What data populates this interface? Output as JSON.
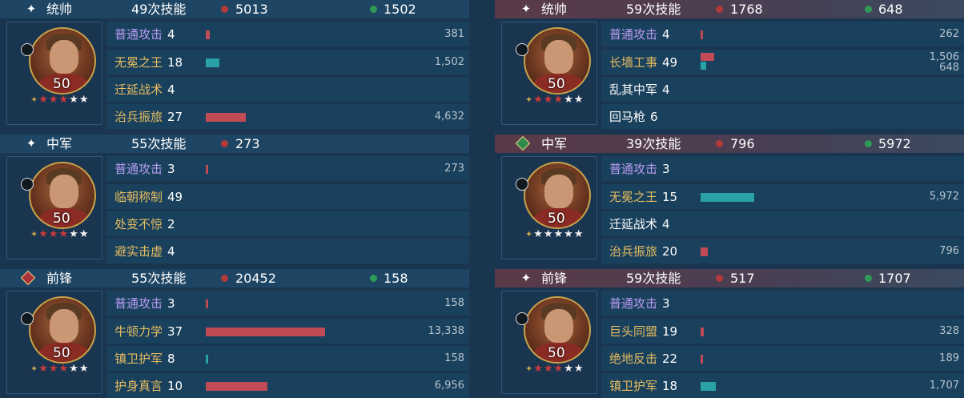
{
  "left": {
    "groups": [
      {
        "role": "统帅",
        "skills": "49次技能",
        "damage": "5013",
        "heal": "1502",
        "level": "50",
        "stars_red": "★★★",
        "stars_white": "★★",
        "rows": [
          {
            "name": "普通攻击",
            "count": "4",
            "value": "381",
            "bar": 0.02,
            "color": "red",
            "type": "basic"
          },
          {
            "name": "无冕之王",
            "count": "18",
            "value": "1,502",
            "bar": 0.07,
            "color": "teal",
            "type": "skill"
          },
          {
            "name": "迁延战术",
            "count": "4",
            "value": "",
            "bar": 0,
            "color": "red",
            "type": "skill"
          },
          {
            "name": "治兵振旅",
            "count": "27",
            "value": "4,632",
            "bar": 0.2,
            "color": "red",
            "type": "skill"
          }
        ]
      },
      {
        "role": "中军",
        "skills": "55次技能",
        "damage": "273",
        "heal": "",
        "level": "50",
        "stars_red": "★★★",
        "stars_white": "★★",
        "rows": [
          {
            "name": "普通攻击",
            "count": "3",
            "value": "273",
            "bar": 0.012,
            "color": "red",
            "type": "basic"
          },
          {
            "name": "临朝称制",
            "count": "49",
            "value": "",
            "bar": 0,
            "color": "red",
            "type": "skill"
          },
          {
            "name": "处变不惊",
            "count": "2",
            "value": "",
            "bar": 0,
            "color": "red",
            "type": "skill"
          },
          {
            "name": "避实击虚",
            "count": "4",
            "value": "",
            "bar": 0,
            "color": "red",
            "type": "skill"
          }
        ]
      },
      {
        "role": "前锋",
        "skills": "55次技能",
        "damage": "20452",
        "heal": "158",
        "level": "50",
        "stars_red": "★★★",
        "stars_white": "★★",
        "rows": [
          {
            "name": "普通攻击",
            "count": "3",
            "value": "158",
            "bar": 0.008,
            "color": "red",
            "type": "basic"
          },
          {
            "name": "牛顿力学",
            "count": "37",
            "value": "13,338",
            "bar": 0.6,
            "color": "red",
            "type": "skill"
          },
          {
            "name": "镇卫护军",
            "count": "8",
            "value": "158",
            "bar": 0.008,
            "color": "teal",
            "type": "skill"
          },
          {
            "name": "护身真言",
            "count": "10",
            "value": "6,956",
            "bar": 0.31,
            "color": "red",
            "type": "skill"
          }
        ]
      }
    ]
  },
  "right": {
    "groups": [
      {
        "role": "统帅",
        "skills": "59次技能",
        "damage": "1768",
        "heal": "648",
        "level": "50",
        "stars_red": "★★★",
        "stars_white": "★★",
        "rows": [
          {
            "name": "普通攻击",
            "count": "4",
            "value": "262",
            "bar": 0.012,
            "color": "red",
            "type": "basic"
          },
          {
            "name": "长墙工事",
            "count": "49",
            "value": "1,506",
            "value2": "648",
            "bar": 0.07,
            "bar2": 0.03,
            "color": "red",
            "type": "skill"
          },
          {
            "name": "乱其中军",
            "count": "4",
            "value": "",
            "bar": 0,
            "color": "red",
            "type": "plain"
          },
          {
            "name": "回马枪",
            "count": "6",
            "value": "",
            "bar": 0,
            "color": "red",
            "type": "plain"
          }
        ]
      },
      {
        "role": "中军",
        "skills": "39次技能",
        "damage": "796",
        "heal": "5972",
        "level": "50",
        "stars_red": "",
        "stars_white": "★★★★★",
        "rows": [
          {
            "name": "普通攻击",
            "count": "3",
            "value": "",
            "bar": 0,
            "color": "red",
            "type": "basic"
          },
          {
            "name": "无冕之王",
            "count": "15",
            "value": "5,972",
            "bar": 0.27,
            "color": "teal",
            "type": "skill"
          },
          {
            "name": "迁延战术",
            "count": "4",
            "value": "",
            "bar": 0,
            "color": "red",
            "type": "plain"
          },
          {
            "name": "治兵振旅",
            "count": "20",
            "value": "796",
            "bar": 0.035,
            "color": "red",
            "type": "skill"
          }
        ]
      },
      {
        "role": "前锋",
        "skills": "59次技能",
        "damage": "517",
        "heal": "1707",
        "level": "50",
        "stars_red": "★★★",
        "stars_white": "★★",
        "rows": [
          {
            "name": "普通攻击",
            "count": "3",
            "value": "",
            "bar": 0,
            "color": "red",
            "type": "basic"
          },
          {
            "name": "巨头同盟",
            "count": "19",
            "value": "328",
            "bar": 0.015,
            "color": "red",
            "type": "skill"
          },
          {
            "name": "绝地反击",
            "count": "22",
            "value": "189",
            "bar": 0.009,
            "color": "red",
            "type": "skill"
          },
          {
            "name": "镇卫护军",
            "count": "18",
            "value": "1,707",
            "bar": 0.075,
            "color": "teal",
            "type": "skill"
          }
        ]
      }
    ]
  },
  "icons": {
    "role_commander": "sparkle-icon",
    "role_middle": "sparkle-icon",
    "role_middle_right": "heart-diamond-icon",
    "role_vanguard_left": "sword-diamond-icon",
    "role_vanguard_right": "sparkle-icon"
  },
  "colors": {
    "damage": "#b23a3a",
    "heal": "#2f9a55",
    "skill_name": "#e6bd61",
    "basic_name": "#b79cf1"
  }
}
